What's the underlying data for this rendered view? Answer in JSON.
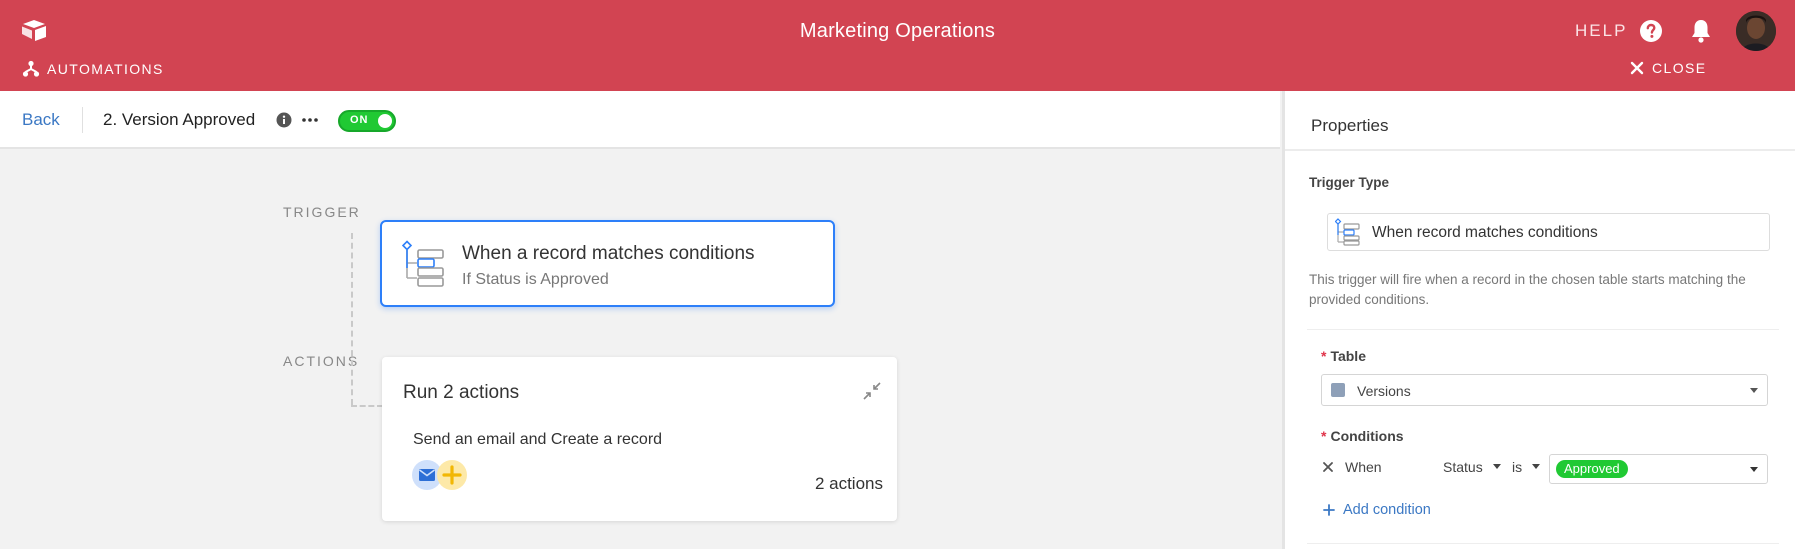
{
  "header": {
    "title": "Marketing Operations",
    "help_label": "HELP",
    "automations_label": "AUTOMATIONS",
    "close_label": "CLOSE"
  },
  "toolbar": {
    "back_label": "Back",
    "automation_name": "2. Version Approved",
    "toggle_label": "ON"
  },
  "canvas": {
    "trigger_section": "TRIGGER",
    "actions_section": "ACTIONS",
    "trigger_card": {
      "title": "When a record matches conditions",
      "subtitle": "If Status is Approved"
    },
    "actions_card": {
      "title": "Run 2 actions",
      "description": "Send an email and Create a record",
      "count": "2 actions"
    }
  },
  "properties": {
    "title": "Properties",
    "trigger_type_label": "Trigger Type",
    "trigger_type_value": "When record matches conditions",
    "trigger_description": "This trigger will fire when a record in the chosen table starts matching the provided conditions.",
    "table_label": "Table",
    "table_value": "Versions",
    "conditions_label": "Conditions",
    "condition": {
      "when": "When",
      "field": "Status",
      "operator": "is",
      "value": "Approved"
    },
    "add_condition_label": "Add condition",
    "required_mark": "*"
  },
  "colors": {
    "header_bg": "#d24452",
    "accent_blue": "#2d7ff9",
    "toggle_green": "#20c933",
    "approved_green": "#20c933"
  }
}
